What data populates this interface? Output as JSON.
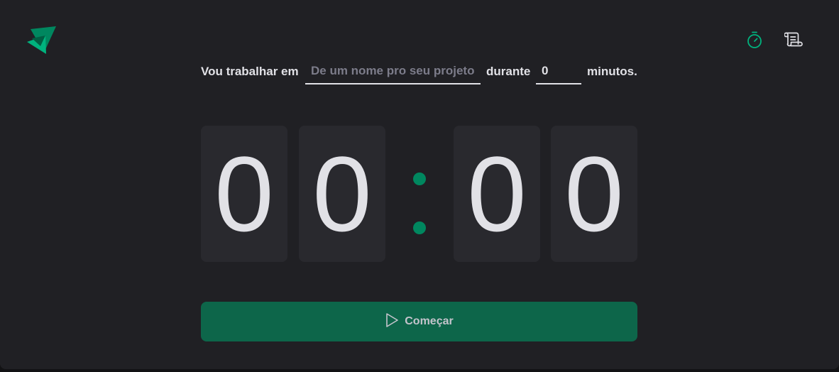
{
  "header": {
    "logo_icon": "green-triangles-logo",
    "nav": [
      {
        "icon": "timer-icon",
        "active": true
      },
      {
        "icon": "scroll-icon",
        "active": false
      }
    ]
  },
  "form": {
    "task_label": "Vou trabalhar em",
    "task_placeholder": "De um nome pro seu projeto",
    "duration_label": "durante",
    "minutes_value": "0",
    "minutes_label": "minutos."
  },
  "countdown": {
    "minute_tens": "0",
    "minute_ones": "0",
    "separator": ":",
    "second_tens": "0",
    "second_ones": "0"
  },
  "start_button": {
    "icon": "play-icon",
    "label": "Começar"
  },
  "colors": {
    "background": "#202024",
    "card": "#29292e",
    "accent": "#00875f",
    "button": "#0d664a",
    "text": "#e1e1e6",
    "placeholder": "#7c7c8a"
  }
}
